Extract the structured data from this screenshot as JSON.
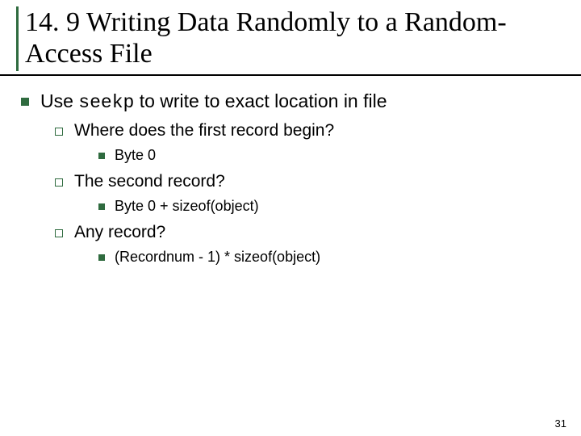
{
  "title": {
    "section_number": "14. 9",
    "spacer": "      ",
    "text": "Writing Data Randomly to a Random-Access File"
  },
  "content": {
    "lvl1": {
      "pre": "Use ",
      "code": "seekp",
      "post": " to write to exact location in file"
    },
    "q1": {
      "text": "Where does the first record begin?",
      "ans": "Byte 0"
    },
    "q2": {
      "text": "The second record?",
      "ans": "Byte 0 + sizeof(object)"
    },
    "q3": {
      "text": "Any record?",
      "ans": "(Recordnum - 1) * sizeof(object)"
    }
  },
  "page_number": "31"
}
